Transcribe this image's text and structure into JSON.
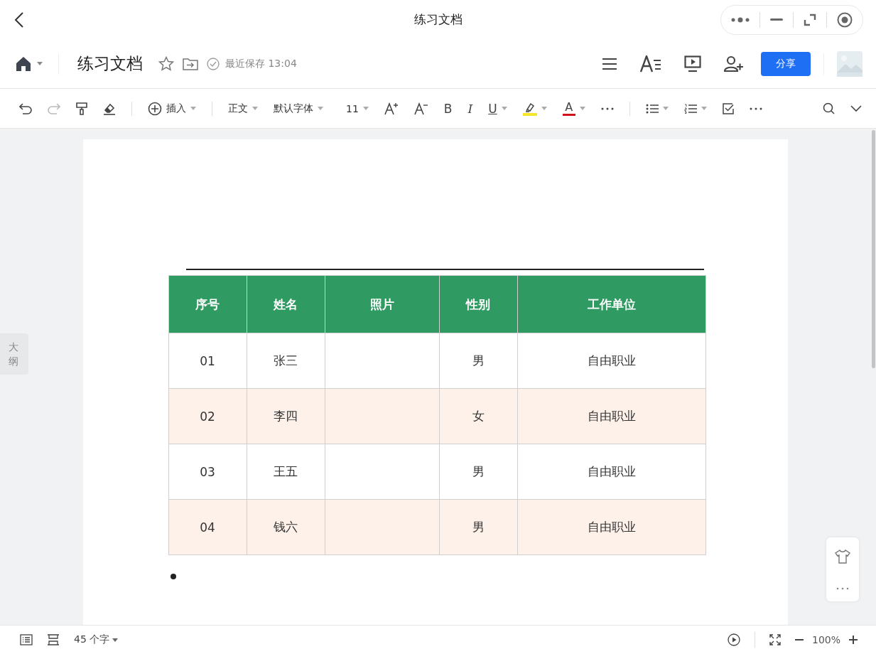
{
  "window": {
    "title": "练习文档"
  },
  "header": {
    "doc_title": "练习文档",
    "save_status": "最近保存 13:04",
    "share_button": "分享"
  },
  "toolbar": {
    "redo_disabled": true,
    "insert": "插入",
    "style": "正文",
    "font": "默认字体",
    "size": "11",
    "bold": "B",
    "italic": "I",
    "underline": "U",
    "highlight": {
      "color": "#f5e62a"
    },
    "font_color": {
      "label": "A",
      "color": "#d0121b"
    }
  },
  "outline_tab": "大纲",
  "table": {
    "columns": [
      "序号",
      "姓名",
      "照片",
      "性别",
      "工作单位"
    ],
    "rows": [
      [
        "01",
        "张三",
        "",
        "男",
        "自由职业"
      ],
      [
        "02",
        "李四",
        "",
        "女",
        "自由职业"
      ],
      [
        "03",
        "王五",
        "",
        "男",
        "自由职业"
      ],
      [
        "04",
        "钱六",
        "",
        "男",
        "自由职业"
      ]
    ]
  },
  "status_bar": {
    "word_count": "45 个字",
    "zoom": "100%"
  }
}
